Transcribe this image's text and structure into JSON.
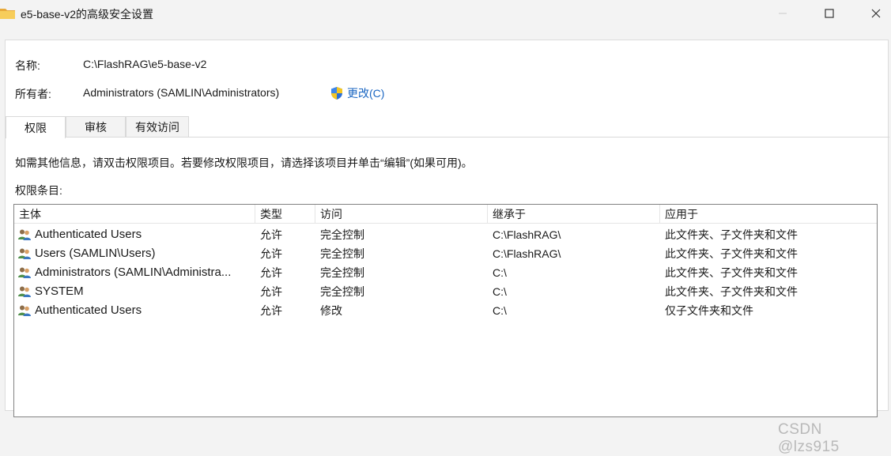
{
  "window": {
    "title": "e5-base-v2的高级安全设置",
    "icon": "folder-icon",
    "controls": [
      "minimize-icon",
      "maximize-icon",
      "close-icon"
    ]
  },
  "name_row": {
    "label": "名称:",
    "value": "C:\\FlashRAG\\e5-base-v2"
  },
  "owner_row": {
    "label": "所有者:",
    "value": "Administrators (SAMLIN\\Administrators)",
    "change_link": "更改(C)",
    "change_icon": "uac-shield-icon"
  },
  "tabs": [
    {
      "label": "权限",
      "active": true
    },
    {
      "label": "审核",
      "active": false
    },
    {
      "label": "有效访问",
      "active": false
    }
  ],
  "info_text": "如需其他信息，请双击权限项目。若要修改权限项目，请选择该项目并单击“编辑”(如果可用)。",
  "list_label": "权限条目:",
  "table": {
    "columns": [
      "主体",
      "类型",
      "访问",
      "继承于",
      "应用于"
    ],
    "rows": [
      {
        "principal": "Authenticated Users",
        "type": "允许",
        "access": "完全控制",
        "inherited": "C:\\FlashRAG\\",
        "applies": "此文件夹、子文件夹和文件"
      },
      {
        "principal": "Users (SAMLIN\\Users)",
        "type": "允许",
        "access": "完全控制",
        "inherited": "C:\\FlashRAG\\",
        "applies": "此文件夹、子文件夹和文件"
      },
      {
        "principal": "Administrators (SAMLIN\\Administra...",
        "type": "允许",
        "access": "完全控制",
        "inherited": "C:\\",
        "applies": "此文件夹、子文件夹和文件"
      },
      {
        "principal": "SYSTEM",
        "type": "允许",
        "access": "完全控制",
        "inherited": "C:\\",
        "applies": "此文件夹、子文件夹和文件"
      },
      {
        "principal": "Authenticated Users",
        "type": "允许",
        "access": "修改",
        "inherited": "C:\\",
        "applies": "仅子文件夹和文件"
      }
    ]
  },
  "watermark": "CSDN @lzs915",
  "colors": {
    "link": "#1a66c2",
    "folder": "#f2c14e"
  }
}
